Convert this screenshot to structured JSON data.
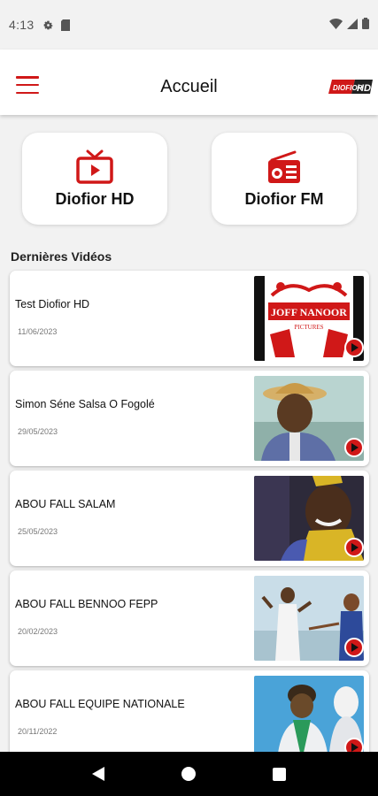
{
  "status_bar": {
    "time": "4:13"
  },
  "app_bar": {
    "title": "Accueil",
    "logo_text": "DIOFIOR HD"
  },
  "quick_cards": [
    {
      "label": "Diofior HD",
      "icon": "tv-icon"
    },
    {
      "label": "Diofior FM",
      "icon": "radio-icon"
    }
  ],
  "section_title": "Dernières Vidéos",
  "videos": [
    {
      "title": "Test Diofior HD",
      "date": "11/06/2023",
      "thumb_text": "JOFF NANOOR",
      "thumb_sub": "PICTURES"
    },
    {
      "title": "Simon Séne Salsa O Fogolé",
      "date": "29/05/2023"
    },
    {
      "title": "ABOU FALL SALAM",
      "date": "25/05/2023"
    },
    {
      "title": "ABOU FALL BENNOO FEPP",
      "date": "20/02/2023"
    },
    {
      "title": "ABOU FALL EQUIPE NATIONALE",
      "date": "20/11/2022"
    }
  ],
  "colors": {
    "accent": "#d01818",
    "background": "#f2f2f2"
  }
}
